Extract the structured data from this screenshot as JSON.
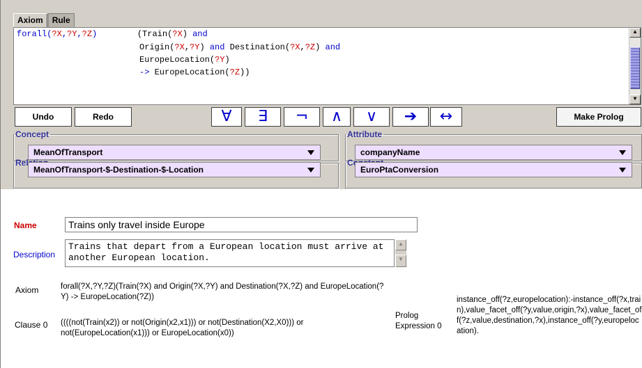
{
  "tabs": [
    {
      "label": "Axiom",
      "active": true
    },
    {
      "label": "Rule",
      "active": false
    }
  ],
  "editor": {
    "lines": [
      [
        {
          "t": "forall(",
          "c": "kw"
        },
        {
          "t": "?X",
          "c": "var"
        },
        {
          "t": ",",
          "c": "kw"
        },
        {
          "t": "?Y",
          "c": "var"
        },
        {
          "t": ",",
          "c": "kw"
        },
        {
          "t": "?Z",
          "c": "var"
        },
        {
          "t": ")",
          "c": "kw"
        },
        {
          "t": "        (Train(",
          "c": ""
        },
        {
          "t": "?X",
          "c": "var"
        },
        {
          "t": ") ",
          "c": ""
        },
        {
          "t": "and",
          "c": "kw"
        }
      ],
      [
        {
          "t": "Origin(",
          "c": ""
        },
        {
          "t": "?X",
          "c": "var"
        },
        {
          "t": ",",
          "c": ""
        },
        {
          "t": "?Y",
          "c": "var"
        },
        {
          "t": ") ",
          "c": ""
        },
        {
          "t": "and",
          "c": "kw"
        },
        {
          "t": " Destination(",
          "c": ""
        },
        {
          "t": "?X",
          "c": "var"
        },
        {
          "t": ",",
          "c": ""
        },
        {
          "t": "?Z",
          "c": "var"
        },
        {
          "t": ") ",
          "c": ""
        },
        {
          "t": "and",
          "c": "kw"
        }
      ],
      [
        {
          "t": "EuropeLocation(",
          "c": ""
        },
        {
          "t": "?Y",
          "c": "var"
        },
        {
          "t": ")",
          "c": ""
        }
      ],
      [
        {
          "t": "->",
          "c": "kw"
        },
        {
          "t": " EuropeLocation(",
          "c": ""
        },
        {
          "t": "?Z",
          "c": "var"
        },
        {
          "t": "))",
          "c": ""
        }
      ]
    ]
  },
  "toolbar": {
    "undo_label": "Undo",
    "redo_label": "Redo",
    "make_prolog_label": "Make Prolog",
    "symbols": [
      "∀",
      "∃",
      "¬",
      "∧",
      "∨",
      "➔",
      "↔"
    ]
  },
  "concept": {
    "legend": "Concept",
    "selected": "MeanOfTransport"
  },
  "attribute": {
    "legend": "Attribute",
    "selected": "companyName"
  },
  "relation": {
    "legend": "Relation",
    "selected": "MeanOfTransport-$-Destination-$-Location"
  },
  "constant": {
    "legend": "Constant",
    "selected": "EuroPtaConversion"
  },
  "form": {
    "name_label": "Name",
    "name_value": "Trains only travel inside Europe",
    "description_label": "Description",
    "description_value": "Trains that depart from a European location must arrive at another European location."
  },
  "output": {
    "axiom_label": "Axiom",
    "axiom_text": "forall(?X,?Y,?Z)(Train(?X) and Origin(?X,?Y) and Destination(?X,?Z) and EuropeLocation(?Y) -> EuropeLocation(?Z))",
    "clause_label": "Clause 0",
    "clause_text": "((((not(Train(x2)) or not(Origin(x2,x1))) or not(Destination(X2,X0))) or not(EuropeLocation(x1))) or EuropeLocation(x0))",
    "prolog_label": "Prolog Expression 0",
    "prolog_text": "instance_off(?z,europelocation):-instance_off(?x,train),value_facet_off(?y,value,origin,?x),value_facet_off(?z,value,destination,?x),instance_off(?y,europelocation)."
  },
  "colors": {
    "panel": "#d4d0c8",
    "keyword": "#0000cc",
    "variable": "#cc0000",
    "dropdown": "#eedeff",
    "legend": "#333399"
  }
}
